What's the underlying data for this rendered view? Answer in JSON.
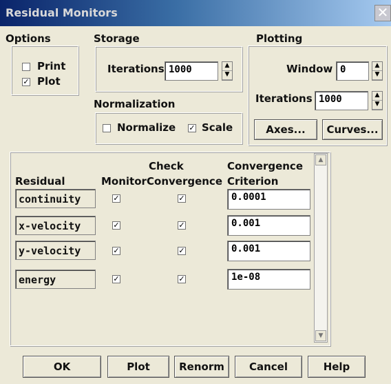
{
  "window": {
    "title": "Residual Monitors",
    "close_glyph": "✕"
  },
  "options": {
    "label": "Options",
    "print_label": "Print",
    "print_checked": false,
    "plot_label": "Plot",
    "plot_checked": true
  },
  "storage": {
    "label": "Storage",
    "iterations_label": "Iterations",
    "iterations_value": "1000"
  },
  "normalization": {
    "label": "Normalization",
    "normalize_label": "Normalize",
    "normalize_checked": false,
    "scale_label": "Scale",
    "scale_checked": true
  },
  "plotting": {
    "label": "Plotting",
    "window_label": "Window",
    "window_value": "0",
    "iterations_label": "Iterations",
    "iterations_value": "1000",
    "axes_label": "Axes...",
    "curves_label": "Curves..."
  },
  "table": {
    "headers": {
      "residual": "Residual",
      "monitor": "Monitor",
      "check_convergence_1": "Check",
      "check_convergence_2": "Convergence",
      "criterion_1": "Convergence",
      "criterion_2": "Criterion"
    },
    "rows": [
      {
        "name": "continuity",
        "monitor": true,
        "check": true,
        "criterion": "0.0001"
      },
      {
        "name": "x-velocity",
        "monitor": true,
        "check": true,
        "criterion": "0.001"
      },
      {
        "name": "y-velocity",
        "monitor": true,
        "check": true,
        "criterion": "0.001"
      },
      {
        "name": "energy",
        "monitor": true,
        "check": true,
        "criterion": "1e-08"
      }
    ]
  },
  "buttons": {
    "ok": "OK",
    "plot": "Plot",
    "renorm": "Renorm",
    "cancel": "Cancel",
    "help": "Help"
  }
}
